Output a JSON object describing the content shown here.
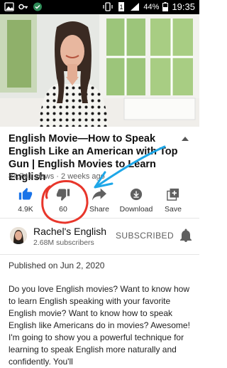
{
  "status_bar": {
    "battery": "44%",
    "time": "19:35",
    "icons": [
      "image-icon",
      "key-icon",
      "shield-icon",
      "vibrate-icon",
      "sim-icon",
      "signal-icon",
      "battery-icon"
    ]
  },
  "video": {
    "title": "English Movie—How to Speak English Like an American with Top Gun | English Movies to Learn English",
    "views": "84,741 views",
    "age": "2 weeks ago"
  },
  "actions": {
    "like_count": "4.9K",
    "dislike_count": "60",
    "share_label": "Share",
    "download_label": "Download",
    "save_label": "Save"
  },
  "channel": {
    "name": "Rachel's English",
    "subscribers": "2.68M subscribers",
    "subscribe_state": "SUBSCRIBED"
  },
  "description": {
    "published": "Published on Jun 2, 2020",
    "text": "Do you love English movies?  Want to know how to learn English speaking with your favorite English movie?  Want to know how to speak English like Americans do in movies?  Awesome!  I'm going to show you a powerful technique for learning to speak English more naturally and confidently.  You'll"
  },
  "colors": {
    "like_blue": "#1a73e8",
    "annotation_red": "#e8362b",
    "annotation_blue": "#1ea7e8"
  }
}
